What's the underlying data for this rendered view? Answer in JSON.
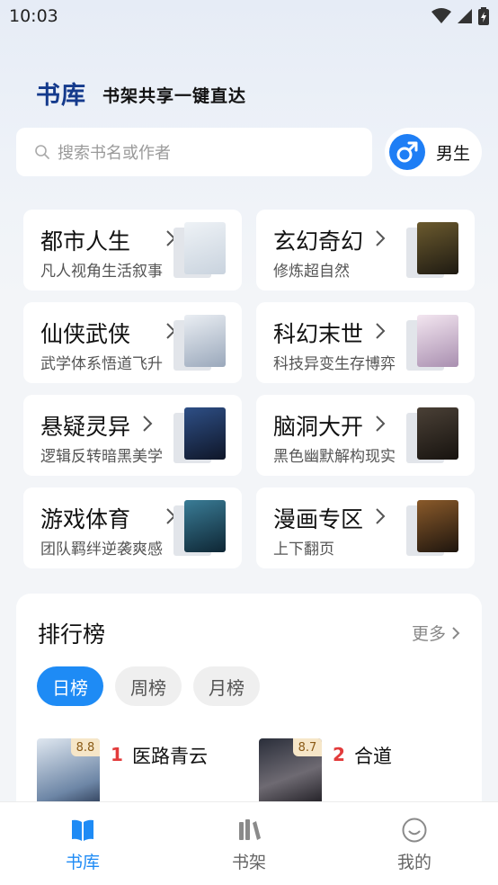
{
  "status_bar": {
    "time": "10:03"
  },
  "header": {
    "brand": "书库",
    "slogan": "书架共享一键直达"
  },
  "search": {
    "placeholder": "搜索书名或作者"
  },
  "gender": {
    "label": "男生",
    "icon": "male-icon"
  },
  "categories": [
    {
      "title": "都市人生",
      "desc": "凡人视角生活叙事",
      "cover_color": "#dfe6ee"
    },
    {
      "title": "玄幻奇幻",
      "desc": "修炼超自然",
      "cover_color": "#3a3424"
    },
    {
      "title": "仙侠武侠",
      "desc": "武学体系悟道飞升",
      "cover_color": "#d9dfe8"
    },
    {
      "title": "科幻末世",
      "desc": "科技异变生存博弈",
      "cover_color": "#e7dbe8"
    },
    {
      "title": "悬疑灵异",
      "desc": "逻辑反转暗黑美学",
      "cover_color": "#1d2b4a"
    },
    {
      "title": "脑洞大开",
      "desc": "黑色幽默解构现实",
      "cover_color": "#2a2520"
    },
    {
      "title": "游戏体育",
      "desc": "团队羁绊逆袭爽感",
      "cover_color": "#1f4a5e"
    },
    {
      "title": "漫画专区",
      "desc": "上下翻页",
      "cover_color": "#3a2a1e"
    }
  ],
  "ranking": {
    "title": "排行榜",
    "more": "更多",
    "tabs": [
      "日榜",
      "周榜",
      "月榜"
    ],
    "active_tab": "日榜",
    "items": [
      {
        "rank": "1",
        "name": "医路青云",
        "score": "8.8"
      },
      {
        "rank": "2",
        "name": "合道",
        "score": "8.7"
      }
    ]
  },
  "nav": {
    "items": [
      {
        "label": "书库",
        "icon": "library-icon",
        "active": true
      },
      {
        "label": "书架",
        "icon": "bookshelf-icon",
        "active": false
      },
      {
        "label": "我的",
        "icon": "profile-icon",
        "active": false
      }
    ]
  },
  "colors": {
    "accent": "#1e8bf5",
    "brand": "#143a8c",
    "rank_number": "#e23b3b"
  }
}
